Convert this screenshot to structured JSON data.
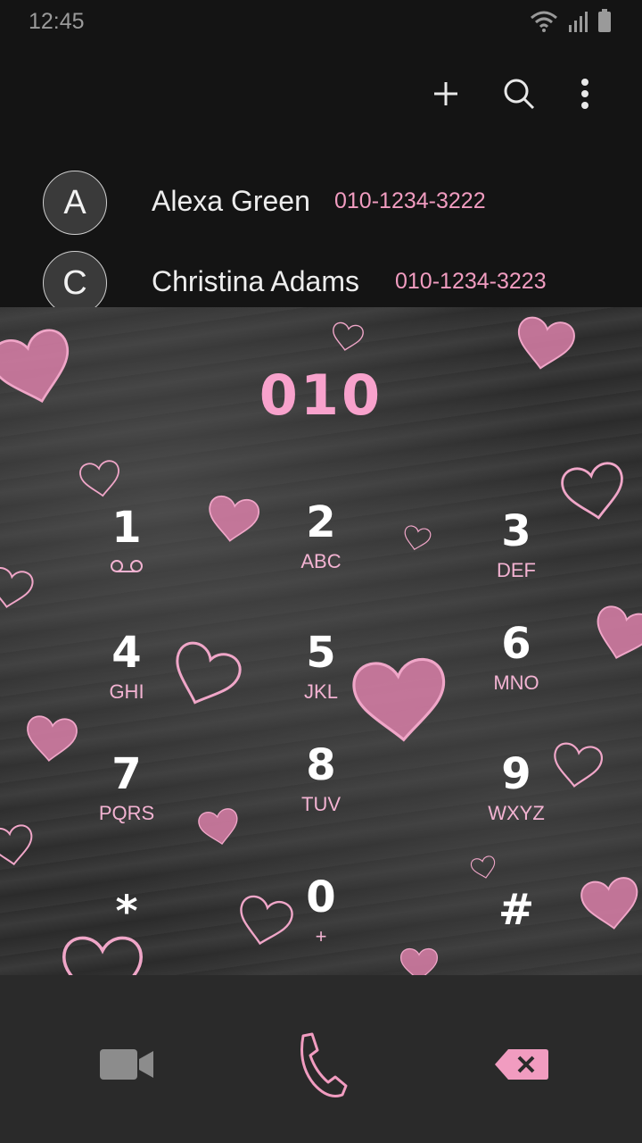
{
  "status_bar": {
    "time": "12:45"
  },
  "toolbar": {
    "add_icon": "plus-icon",
    "search_icon": "search-icon",
    "more_icon": "more-vertical-icon"
  },
  "contacts": [
    {
      "initial": "A",
      "name": "Alexa Green",
      "number": "010-1234-3222"
    },
    {
      "initial": "C",
      "name": "Christina Adams",
      "number": "010-1234-3223"
    }
  ],
  "dialer": {
    "entered_digits": "010",
    "keys": [
      {
        "num": "1",
        "sub": ""
      },
      {
        "num": "2",
        "sub": "ABC"
      },
      {
        "num": "3",
        "sub": "DEF"
      },
      {
        "num": "4",
        "sub": "GHI"
      },
      {
        "num": "5",
        "sub": "JKL"
      },
      {
        "num": "6",
        "sub": "MNO"
      },
      {
        "num": "7",
        "sub": "PQRS"
      },
      {
        "num": "8",
        "sub": "TUV"
      },
      {
        "num": "9",
        "sub": "WXYZ"
      },
      {
        "num": "*",
        "sub": ""
      },
      {
        "num": "0",
        "sub": "+"
      },
      {
        "num": "#",
        "sub": ""
      }
    ]
  },
  "colors": {
    "accent_pink": "#f19cc0",
    "background": "#141414",
    "chalkboard": "#333333"
  }
}
